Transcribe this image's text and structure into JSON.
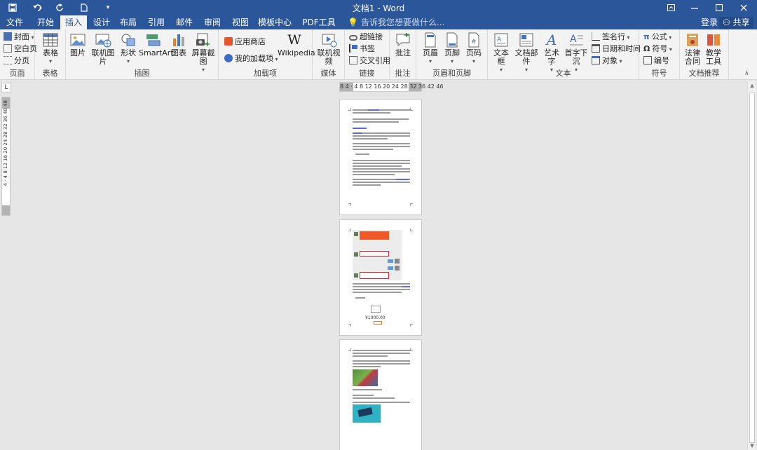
{
  "window": {
    "title": "文档1 - Word"
  },
  "quick_access": {
    "save": "save-icon",
    "undo": "undo-icon",
    "redo": "redo-icon",
    "new": "new-doc-icon",
    "customize": "customize-icon"
  },
  "window_controls": {
    "ribbon_display": "ribbon-display-icon",
    "minimize": "minimize-icon",
    "maximize": "maximize-icon",
    "close": "close-icon"
  },
  "tabs": [
    "文件",
    "开始",
    "插入",
    "设计",
    "布局",
    "引用",
    "邮件",
    "审阅",
    "视图",
    "模板中心",
    "PDF工具集"
  ],
  "active_tab": "插入",
  "tell_me": "告诉我您想要做什么...",
  "account": {
    "login": "登录",
    "share": "共享"
  },
  "ribbon": {
    "pages": {
      "cover": "封面",
      "blank": "空白页",
      "break": "分页",
      "label": "页面"
    },
    "tables": {
      "table": "表格",
      "label": "表格"
    },
    "illustrations": {
      "picture": "图片",
      "online_picture": "联机图片",
      "shapes": "形状",
      "smartart": "SmartArt",
      "chart": "图表",
      "screenshot": "屏幕截图",
      "label": "插图"
    },
    "addins": {
      "store": "应用商店",
      "my_addins": "我的加载项",
      "wikipedia": "Wikipedia",
      "label": "加载项"
    },
    "media": {
      "online_video": "联机视频",
      "label": "媒体"
    },
    "links": {
      "hyperlink": "超链接",
      "bookmark": "书签",
      "cross_ref": "交叉引用",
      "label": "链接"
    },
    "comments": {
      "comment": "批注",
      "label": "批注"
    },
    "header_footer": {
      "header": "页眉",
      "footer": "页脚",
      "page_number": "页码",
      "label": "页眉和页脚"
    },
    "text": {
      "textbox": "文本框",
      "quick_parts": "文档部件",
      "wordart": "艺术字",
      "dropcap": "首字下沉",
      "signature": "签名行",
      "datetime": "日期和时间",
      "object": "对象",
      "label": "文本"
    },
    "symbols": {
      "equation": "公式",
      "symbol": "符号",
      "number": "编号",
      "label": "符号"
    },
    "recommend": {
      "contract": "法律合同",
      "teaching": "教学工具",
      "label": "文档推荐"
    }
  },
  "hruler": {
    "ticks": "8  4  ·  4   8  12 16 20 24 28 32 36  42 46"
  },
  "vruler": {
    "ticks": "4 · 4 8 12 16 20 24 28 32 36 40 48"
  },
  "pages": [
    {
      "name": "page-1"
    },
    {
      "name": "page-2",
      "price": "¥1000.00"
    },
    {
      "name": "page-3"
    }
  ]
}
